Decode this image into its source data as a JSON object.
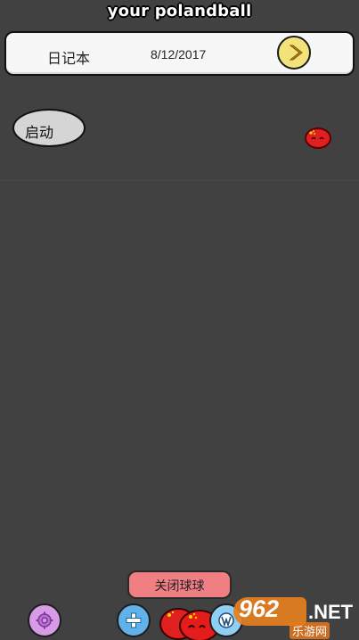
{
  "app": {
    "title": "your polandball"
  },
  "header": {
    "diary_label": "日记本",
    "date": "8/12/2017",
    "next_icon": "chevron-right-icon"
  },
  "main": {
    "start_button_label": "启动"
  },
  "bottom": {
    "close_ball_label": "关闭球球",
    "icons": [
      "gear-icon",
      "plus-icon",
      "polandball-icon",
      "wordpress-icon"
    ]
  },
  "watermark": {
    "number": "962",
    "suffix": ".NET",
    "subtitle": "乐游网"
  },
  "colors": {
    "background": "#414141",
    "ball_red": "#e02020",
    "close_button": "#ef7f83",
    "next_button": "#f3e27a"
  }
}
